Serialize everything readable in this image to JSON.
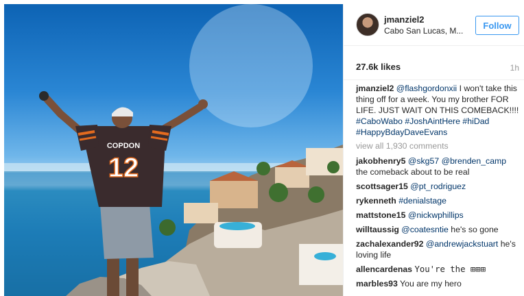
{
  "post": {
    "username": "jmanziel2",
    "location": "Cabo San Lucas, M...",
    "follow_label": "Follow",
    "likes": "27.6k likes",
    "time": "1h",
    "jersey_name": "COPDON",
    "jersey_number": "12",
    "caption": {
      "user": "jmanziel2",
      "mention": "@flashgordonxii",
      "text": " I won't take this thing off for a week. You my brother FOR LIFE. JUST WAIT ON THIS COMEBACK!!!! ",
      "tags": [
        "#CaboWabo",
        "#JoshAintHere",
        "#hiDad",
        "#HappyBdayDaveEvans"
      ]
    },
    "view_all": "view all 1,930 comments",
    "comments": [
      {
        "user": "jakobhenry5",
        "mention": "@skg57",
        "mention2": "@brenden_camp",
        "text": "the comeback about to be real"
      },
      {
        "user": "scottsager15",
        "mention": "@pt_rodriguez",
        "text": ""
      },
      {
        "user": "rykenneth",
        "mention": "#denialstage",
        "text": ""
      },
      {
        "user": "mattstone15",
        "mention": "@nickwphillips",
        "text": ""
      },
      {
        "user": "willtaussig",
        "mention": "@coatesntie",
        "text": "he's so gone"
      },
      {
        "user": "zachalexander92",
        "mention": "@andrewjackstuart",
        "text": "he's loving life"
      },
      {
        "user": "allencardenas",
        "mention": "",
        "text": "You're the ⊞⊞⊞"
      },
      {
        "user": "marbles93",
        "mention": "",
        "text": "You are my hero"
      }
    ]
  }
}
